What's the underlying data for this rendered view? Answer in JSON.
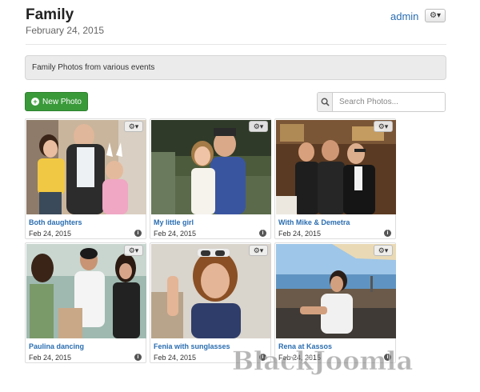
{
  "header": {
    "title": "Family",
    "date": "February 24, 2015"
  },
  "user": {
    "name": "admin",
    "menu_icon": "gear-icon"
  },
  "description": "Family Photos from various events",
  "toolbar": {
    "new_photo_label": "New Photo",
    "search_placeholder": "Search Photos..."
  },
  "photos": [
    {
      "caption": "Both daughters",
      "date": "Feb 24, 2015"
    },
    {
      "caption": "My little girl",
      "date": "Feb 24, 2015"
    },
    {
      "caption": "With Mike & Demetra",
      "date": "Feb 24, 2015"
    },
    {
      "caption": "Paulina dancing",
      "date": "Feb 24, 2015"
    },
    {
      "caption": "Fenia with sunglasses",
      "date": "Feb 24, 2015"
    },
    {
      "caption": "Rena at Kassos",
      "date": "Feb 24, 2015"
    }
  ],
  "watermark": "BlackJoomla",
  "colors": {
    "accent_link": "#2a6db0",
    "button_green": "#3a9a3a"
  }
}
